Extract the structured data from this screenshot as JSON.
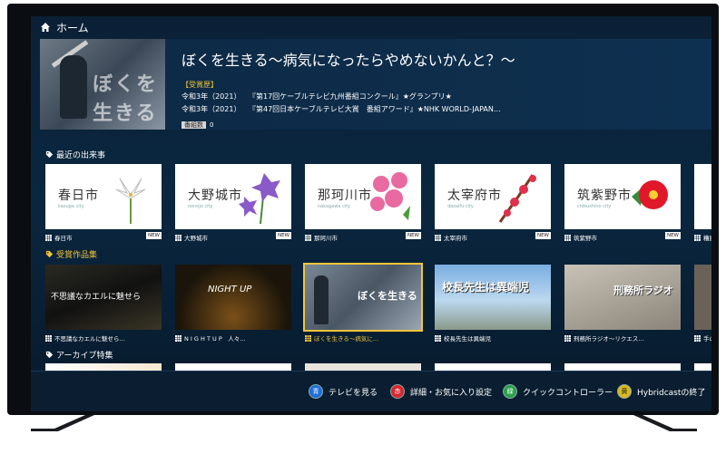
{
  "topbar": {
    "title": "ホーム"
  },
  "hero": {
    "title": "ぼくを生きる～病気になったらやめないかんと？～",
    "image_text": "ぼくを生きる",
    "award_label": "【受賞歴】",
    "awards": [
      {
        "year": "令和3年（2021）",
        "text": "『第17回ケーブルテレビ九州番組コンクール』★グランプリ★"
      },
      {
        "year": "令和3年（2021）",
        "text": "『第47回日本ケーブルテレビ大賞　番組アワード』★NHK WORLD-JAPAN…"
      }
    ],
    "badge_label": "番組数",
    "badge_count": "0"
  },
  "sections": {
    "recent": "最近の出来事",
    "awards": "受賞作品集",
    "archive": "アーカイブ特集"
  },
  "recent_cards": [
    {
      "city": "春日市",
      "en": "kasuga city",
      "caption": "春日市",
      "new": "NEW"
    },
    {
      "city": "大野城市",
      "en": "oonojo city",
      "caption": "大野城市",
      "new": "NEW"
    },
    {
      "city": "那珂川市",
      "en": "nakagawa city",
      "caption": "那珂川市",
      "new": "NEW"
    },
    {
      "city": "太宰府市",
      "en": "dazaifu city",
      "caption": "太宰府市",
      "new": "NEW"
    },
    {
      "city": "筑紫野市",
      "en": "chikushino city",
      "caption": "筑紫野市",
      "new": "NEW"
    },
    {
      "city": "",
      "en": "",
      "caption": "糟屋",
      "new": ""
    }
  ],
  "award_cards": [
    {
      "title": "不思議なカエルに魅せら",
      "caption": "不思議なカエルに魅せら…"
    },
    {
      "title": "NIGHT UP",
      "caption": "N I G H T  U P　人々…"
    },
    {
      "title": "ぼくを生きる",
      "caption": "ぼくを生きる～病気に…"
    },
    {
      "title": "校長先生は異端児",
      "caption": "校長先生は異端児"
    },
    {
      "title": "刑務所ラジオ",
      "caption": "刑務所ラジオ～リクエス…"
    },
    {
      "title": "",
      "caption": "手の"
    }
  ],
  "bottom_buttons": [
    {
      "key": "青",
      "label": "テレビを見る",
      "color": "#1e6fd9"
    },
    {
      "key": "赤",
      "label": "詳細・お気に入り設定",
      "color": "#d8262f"
    },
    {
      "key": "緑",
      "label": "クイックコントローラー",
      "color": "#2aa14a"
    },
    {
      "key": "黄",
      "label": "Hybridcastの終了",
      "color": "#d9b81e"
    }
  ]
}
